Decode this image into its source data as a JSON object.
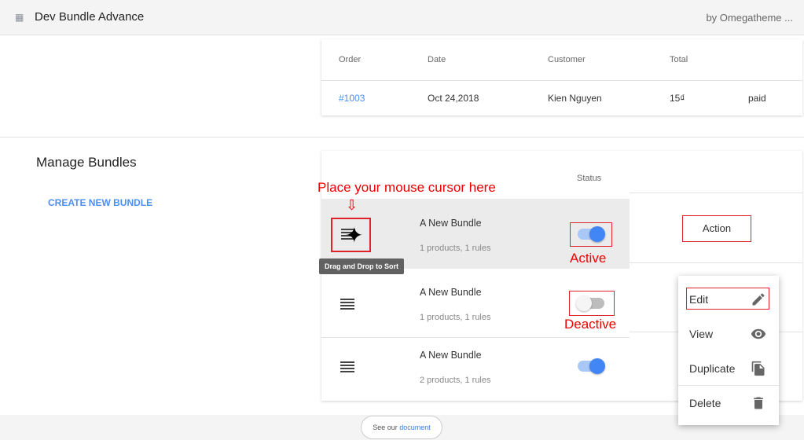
{
  "header": {
    "title": "Dev Bundle Advance",
    "by": "by Omegatheme ..."
  },
  "orders": {
    "columns": [
      "Order",
      "Date",
      "Customer",
      "Total"
    ],
    "rows": [
      {
        "order": "#1003",
        "date": "Oct 24,2018",
        "customer": "Kien Nguyen",
        "total": "15₫",
        "status": "paid"
      }
    ]
  },
  "manage": {
    "title": "Manage Bundles",
    "create": "CREATE NEW BUNDLE",
    "status_header": "Status",
    "bundles": [
      {
        "name": "A New Bundle",
        "meta": "1 products, 1 rules",
        "active": true
      },
      {
        "name": "A New Bundle",
        "meta": "1 products, 1 rules",
        "active": false
      },
      {
        "name": "A New Bundle",
        "meta": "2 products, 1 rules",
        "active": true
      }
    ],
    "action": "Action",
    "tooltip": "Drag and Drop to Sort"
  },
  "annotations": {
    "cursor_hint": "Place your mouse cursor here",
    "active": "Active",
    "deactive": "Deactive"
  },
  "menu": {
    "items": [
      "Edit",
      "View",
      "Duplicate",
      "Delete"
    ]
  },
  "footer": {
    "prefix": "See our",
    "link": "document"
  }
}
